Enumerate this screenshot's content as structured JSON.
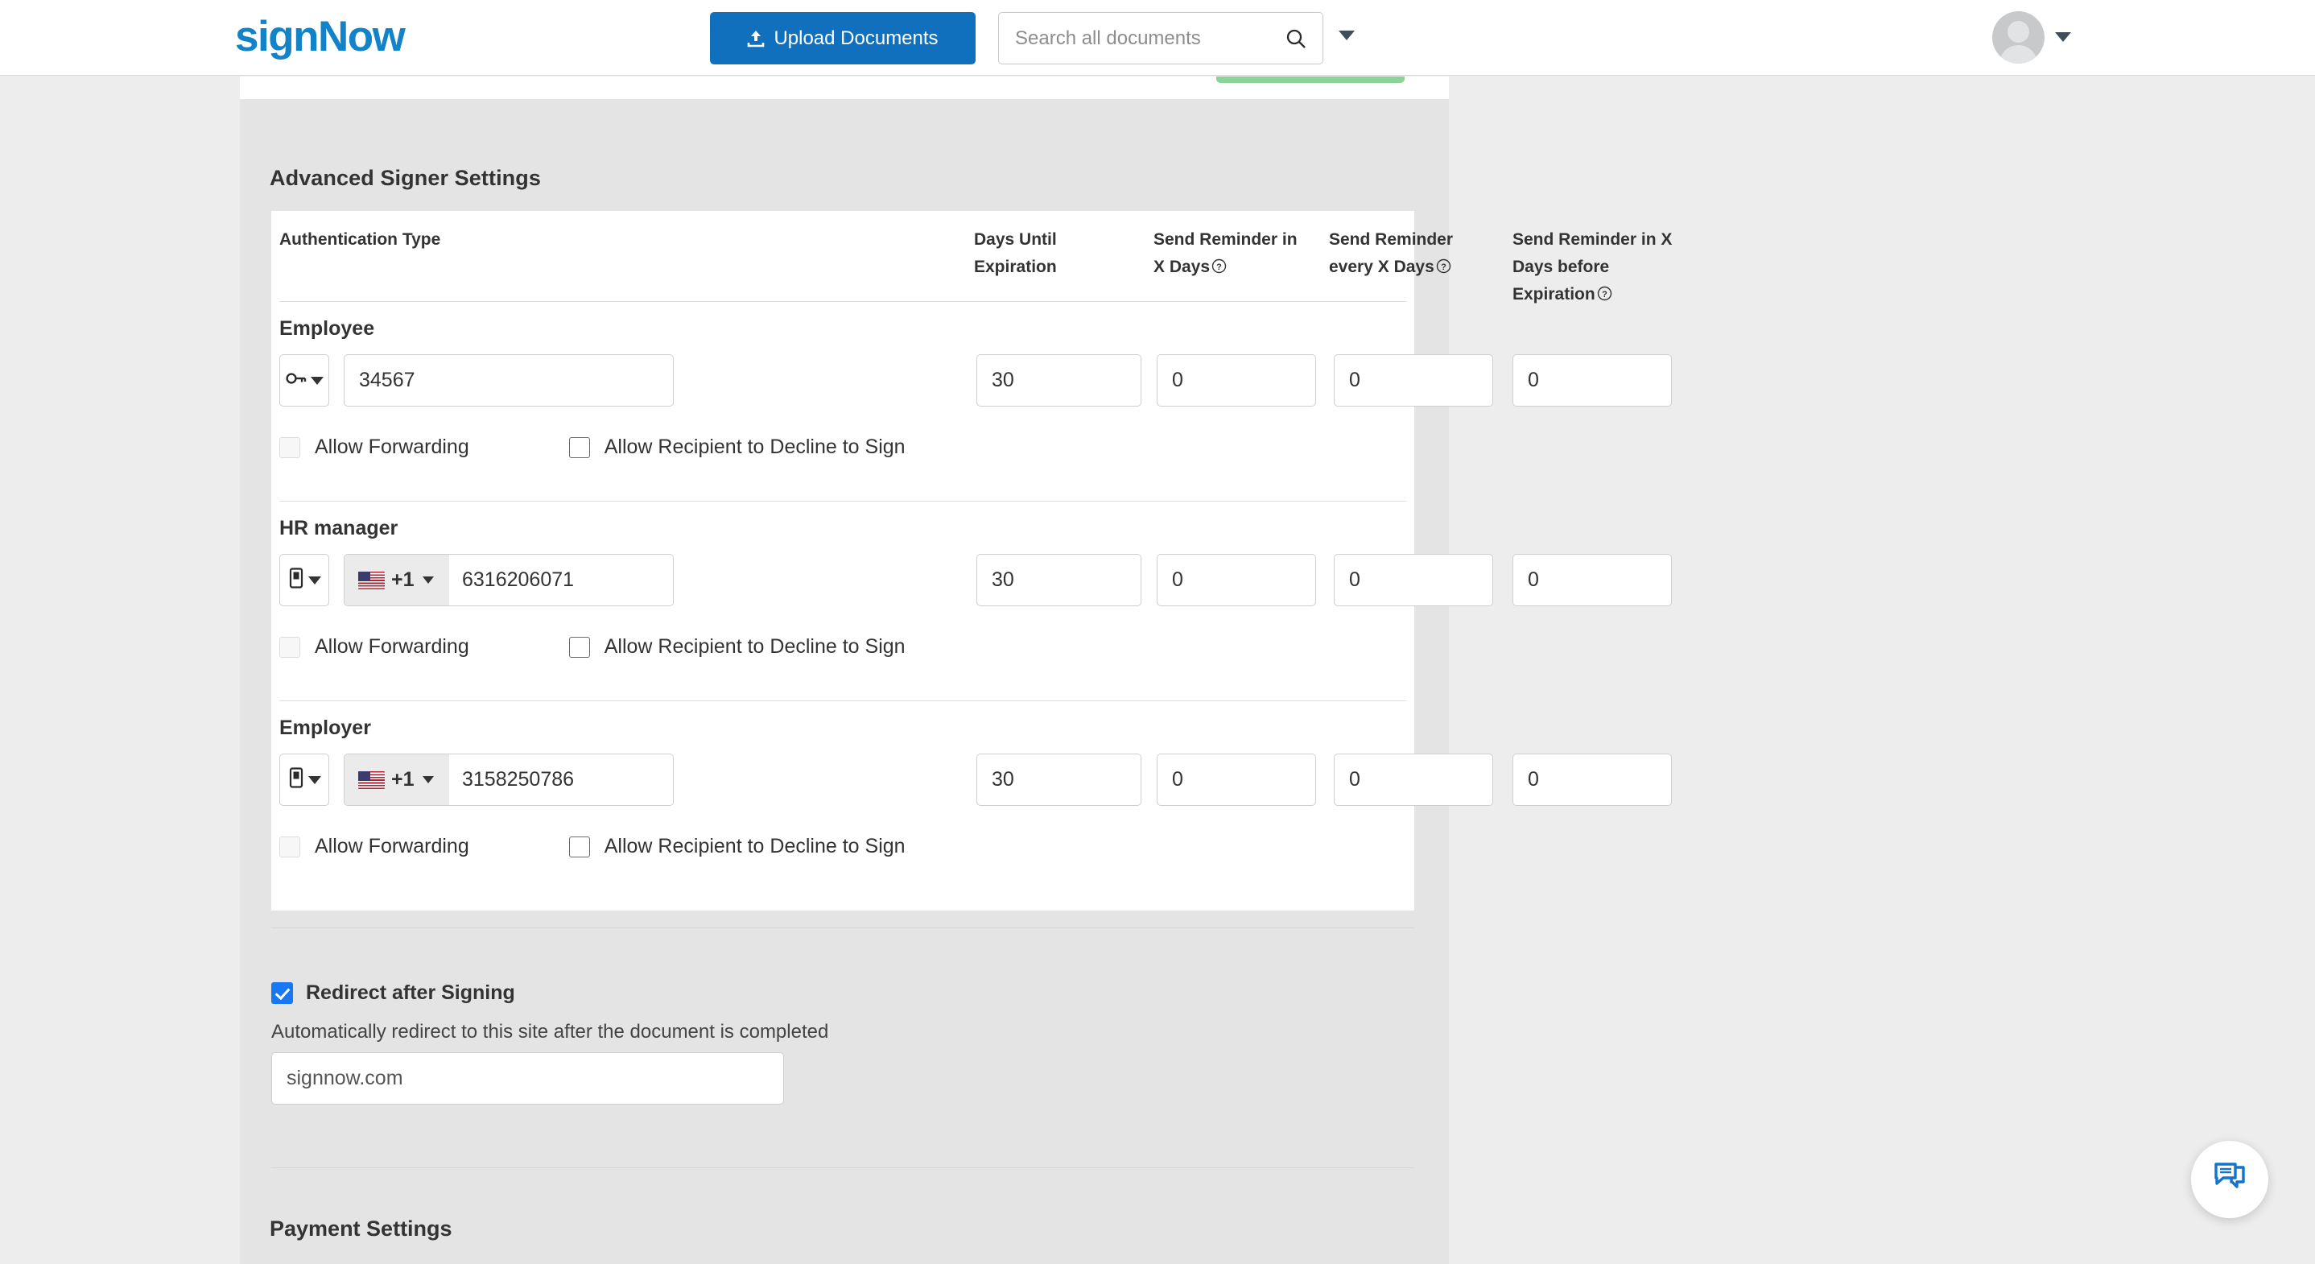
{
  "header": {
    "logo": "signNow",
    "upload_label": "Upload Documents",
    "upload_icon": "upload-icon",
    "search_placeholder": "Search all documents",
    "search_value": "",
    "search_icon": "search-icon",
    "search_caret_icon": "chevron-down-icon",
    "avatar_icon": "user-avatar-icon",
    "avatar_caret_icon": "chevron-down-icon",
    "accent_blue": "#1070bd",
    "logo_blue": "#1283c8"
  },
  "section": {
    "title": "Advanced Signer Settings"
  },
  "table": {
    "headers": {
      "auth_type": "Authentication Type",
      "days_until_expiration": "Days Until Expiration",
      "send_reminder_in_x_days": "Send Reminder in X Days",
      "send_reminder_every_x_days": "Send Reminder every X Days",
      "send_reminder_before_expiration": "Send Reminder in X Days before Expiration"
    },
    "help_icon": "help-circle-icon"
  },
  "signers": [
    {
      "name": "Employee",
      "auth_icon": "key-icon",
      "auth_type": "password",
      "has_phone": false,
      "value": "34567",
      "days_until_expiration": "30",
      "reminder_in_days": "0",
      "reminder_every_days": "0",
      "reminder_before_expiration": "0",
      "allow_forwarding_label": "Allow Forwarding",
      "allow_forwarding_checked": false,
      "allow_forwarding_disabled": true,
      "allow_decline_label": "Allow Recipient to Decline to Sign",
      "allow_decline_checked": false
    },
    {
      "name": "HR manager",
      "auth_icon": "mobile-phone-icon",
      "auth_type": "sms",
      "has_phone": true,
      "country_flag": "us-flag-icon",
      "country_code": "+1",
      "value": "6316206071",
      "days_until_expiration": "30",
      "reminder_in_days": "0",
      "reminder_every_days": "0",
      "reminder_before_expiration": "0",
      "allow_forwarding_label": "Allow Forwarding",
      "allow_forwarding_checked": false,
      "allow_forwarding_disabled": true,
      "allow_decline_label": "Allow Recipient to Decline to Sign",
      "allow_decline_checked": false
    },
    {
      "name": "Employer",
      "auth_icon": "mobile-phone-icon",
      "auth_type": "sms",
      "has_phone": true,
      "country_flag": "us-flag-icon",
      "country_code": "+1",
      "value": "3158250786",
      "days_until_expiration": "30",
      "reminder_in_days": "0",
      "reminder_every_days": "0",
      "reminder_before_expiration": "0",
      "allow_forwarding_label": "Allow Forwarding",
      "allow_forwarding_checked": false,
      "allow_forwarding_disabled": true,
      "allow_decline_label": "Allow Recipient to Decline to Sign",
      "allow_decline_checked": false
    }
  ],
  "redirect": {
    "title": "Redirect after Signing",
    "checked": true,
    "checkbox_color": "#1877f2",
    "description": "Automatically redirect to this site after the document is completed",
    "url_value": "signnow.com"
  },
  "payment": {
    "title": "Payment Settings"
  },
  "chat": {
    "icon": "chat-bubble-icon",
    "color": "#1274ca"
  }
}
